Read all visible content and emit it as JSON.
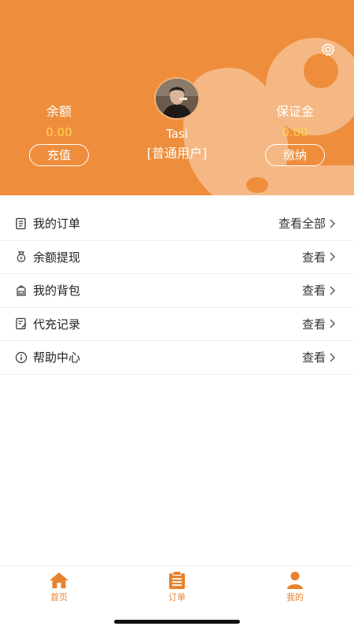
{
  "colors": {
    "brand": "#ee8e3d",
    "accent_value": "#ffd24a",
    "tab_active": "#e8822f"
  },
  "header": {
    "balance": {
      "label": "余额",
      "value": "0.00",
      "button": "充值"
    },
    "deposit": {
      "label": "保证金",
      "value": "0.00",
      "button": "缴纳"
    },
    "user": {
      "name": "Tasi",
      "type": "[普通用户]"
    },
    "settings_icon": "settings-icon"
  },
  "menu": [
    {
      "icon": "order-list-icon",
      "label": "我的订单",
      "action": "查看全部"
    },
    {
      "icon": "money-bag-icon",
      "label": "余额提现",
      "action": "查看"
    },
    {
      "icon": "backpack-icon",
      "label": "我的背包",
      "action": "查看"
    },
    {
      "icon": "record-icon",
      "label": "代充记录",
      "action": "查看"
    },
    {
      "icon": "info-icon",
      "label": "帮助中心",
      "action": "查看"
    }
  ],
  "tabbar": [
    {
      "icon": "home-icon",
      "label": "首页"
    },
    {
      "icon": "clipboard-icon",
      "label": "订单"
    },
    {
      "icon": "person-icon",
      "label": "我的"
    }
  ]
}
